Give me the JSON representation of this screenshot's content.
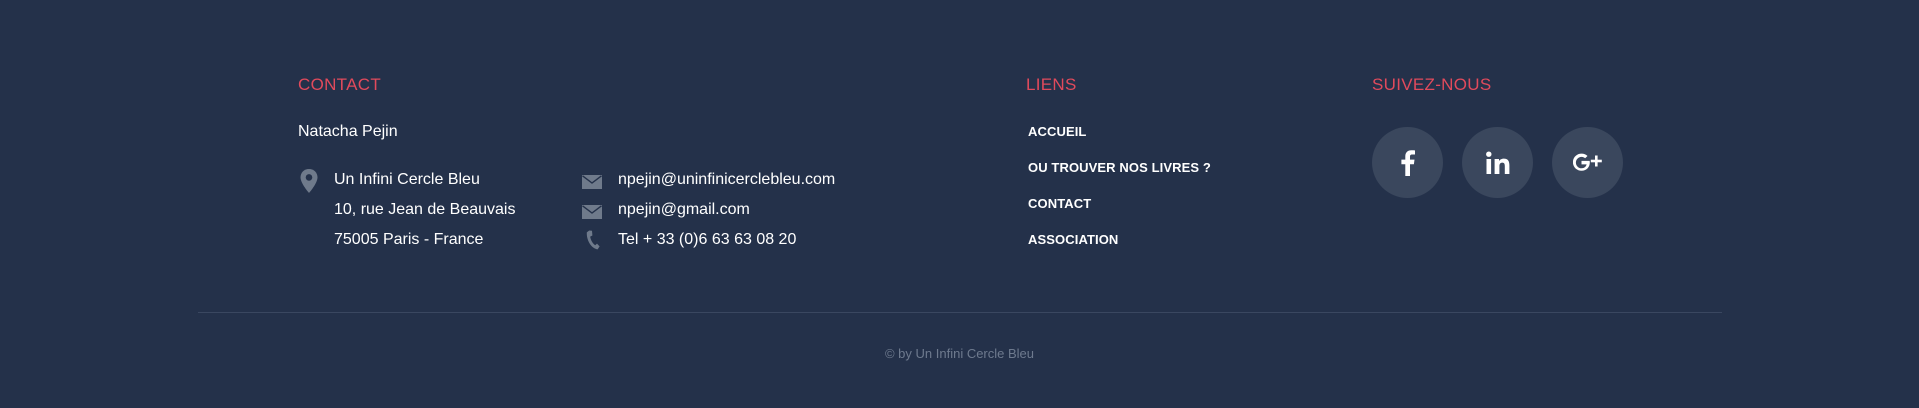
{
  "colors": {
    "background": "#24314a",
    "accent": "#e14a5c",
    "text": "#ffffff",
    "icon": "#6f7a8b",
    "social_bg": "#3a475d",
    "muted": "#6e7a8e"
  },
  "contact": {
    "heading": "CONTACT",
    "name": "Natacha Pejin",
    "address": {
      "icon": "map-pin-icon",
      "line1": "Un Infini Cercle Bleu",
      "line2": "10, rue Jean de Beauvais",
      "line3": "75005 Paris - France"
    },
    "emails": [
      {
        "icon": "mail-icon",
        "value": "npejin@uninfinicerclebleu.com"
      },
      {
        "icon": "mail-icon",
        "value": "npejin@gmail.com"
      }
    ],
    "phone": {
      "icon": "phone-icon",
      "value": "Tel + 33 (0)6 63 63 08 20"
    }
  },
  "links": {
    "heading": "LIENS",
    "items": [
      {
        "label": "ACCUEIL"
      },
      {
        "label": "OU TROUVER NOS LIVRES ?"
      },
      {
        "label": "CONTACT"
      },
      {
        "label": "ASSOCIATION"
      }
    ]
  },
  "social": {
    "heading": "SUIVEZ-NOUS",
    "items": [
      {
        "icon": "facebook-icon"
      },
      {
        "icon": "linkedin-icon"
      },
      {
        "icon": "google-plus-icon"
      }
    ]
  },
  "footer": {
    "copyright": "© by Un Infini Cercle Bleu"
  }
}
